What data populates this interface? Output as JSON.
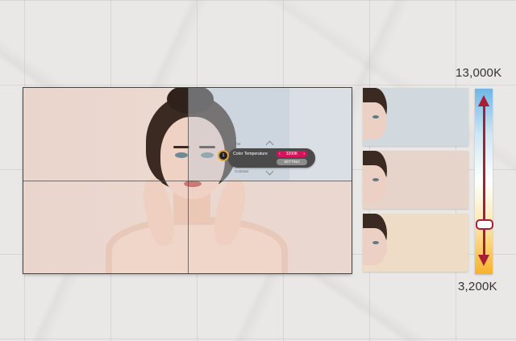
{
  "scale": {
    "max_label": "13,000K",
    "min_label": "3,200K",
    "level_fraction": 0.2
  },
  "osd": {
    "above_item": "Tint",
    "selected_item": "Color Temperature",
    "selected_value": "3200K",
    "setting_button": "SETTING",
    "below_item": "Contrast",
    "badge": "1"
  },
  "colors": {
    "scale_top": "#6fb6e6",
    "scale_bottom": "#f7b229",
    "arrow": "#a81e35",
    "highlight": "#d4145a"
  }
}
